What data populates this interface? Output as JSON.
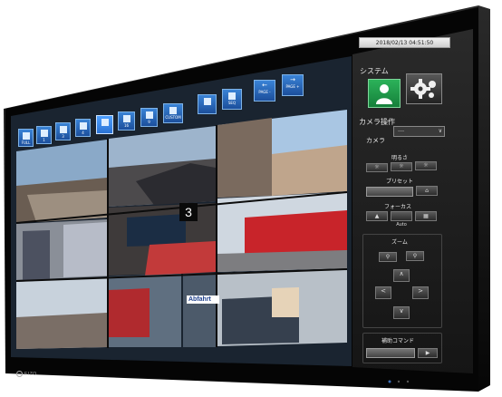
{
  "monitor": {
    "brand": "EIZO"
  },
  "toolbar": {
    "buttons": [
      {
        "label": "FULL",
        "icon": "single-view-icon"
      },
      {
        "label": "1",
        "icon": "layout-1-icon"
      },
      {
        "label": "3",
        "icon": "layout-3-icon"
      },
      {
        "label": "4",
        "icon": "layout-4-icon"
      },
      {
        "label": "",
        "icon": "layout-grid-icon"
      },
      {
        "label": "16",
        "icon": "layout-16-icon"
      },
      {
        "label": "9",
        "icon": "layout-9-icon"
      },
      {
        "label": "CUSTOM",
        "icon": "custom-layout-icon"
      },
      {
        "label": "",
        "icon": "display-icon"
      },
      {
        "label": "SEQ",
        "icon": "sequence-icon"
      },
      {
        "label": "PAGE -",
        "icon": "page-prev-icon"
      },
      {
        "label": "PAGE +",
        "icon": "page-next-icon"
      }
    ]
  },
  "camera_tiles": {
    "overlay_number": "3",
    "sign_text": "Abfahrt"
  },
  "side_panel": {
    "datetime": "2018/02/13 04:51:50",
    "system_label": "システム",
    "camera_ops_label": "カメラ操作",
    "camera_label": "カメラ",
    "camera_select_value": "----",
    "brightness_label": "明るさ",
    "preset_label": "プリセット",
    "focus_label": "フォーカス",
    "focus_auto_label": "Auto",
    "zoom_label": "ズーム",
    "aux_label": "補助コマンド"
  },
  "colors": {
    "accent_blue": "#1f6fd1",
    "user_green": "#1f9a45",
    "panel_bg": "#1a1a1a",
    "bezel": "#0b0b0b"
  }
}
